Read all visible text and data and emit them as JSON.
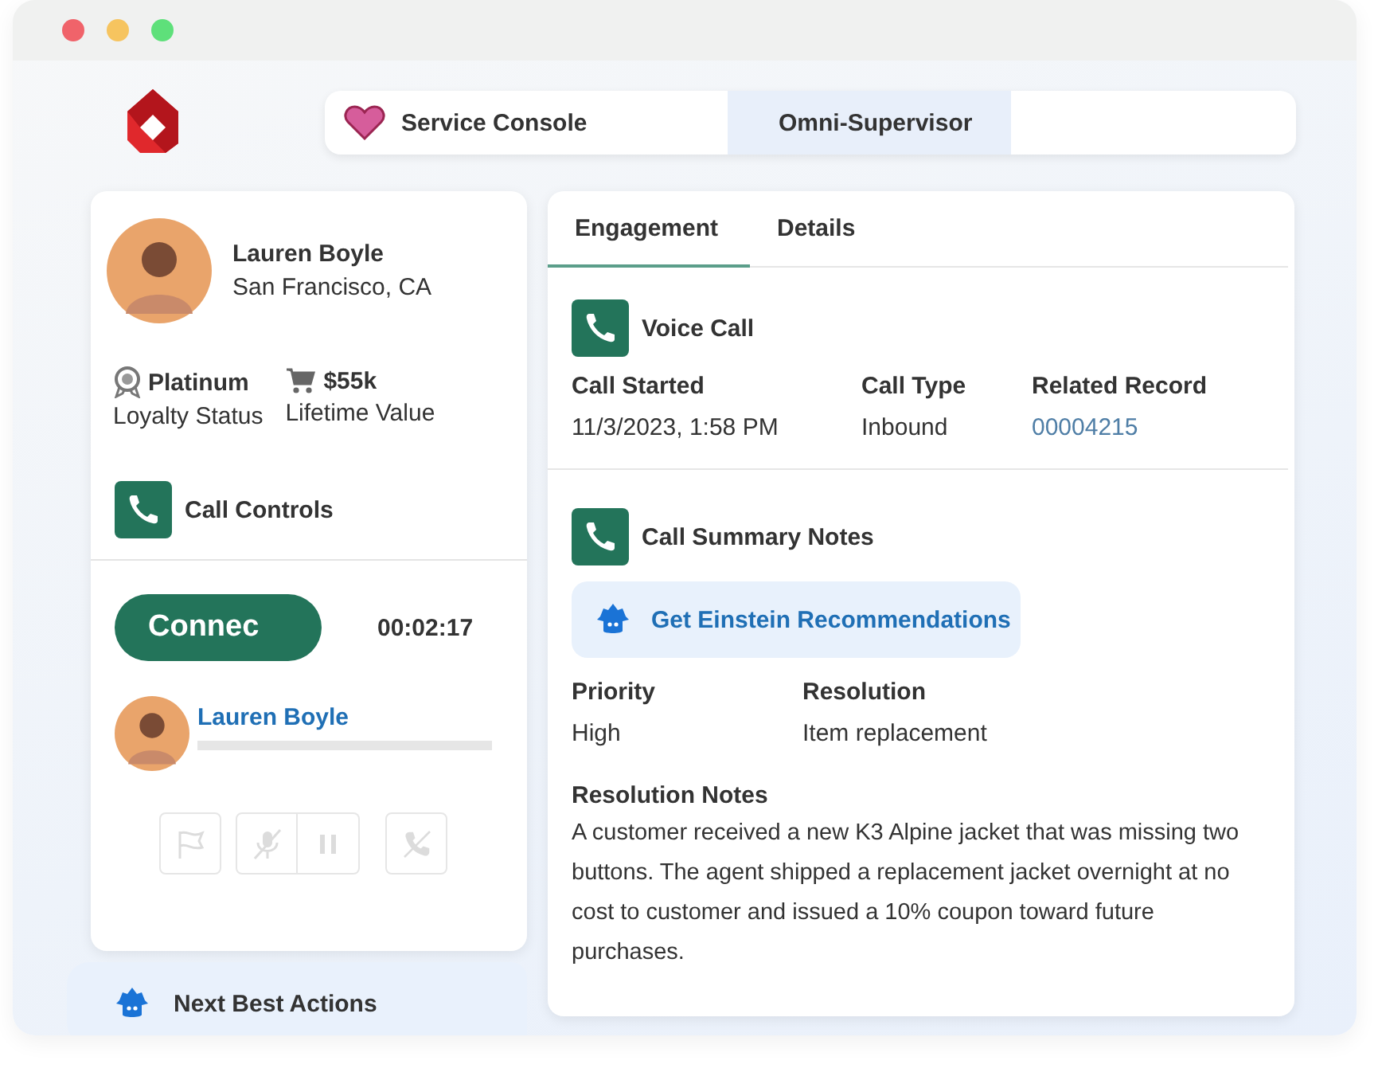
{
  "header_tabs": [
    {
      "label": "Service Console",
      "selected": false,
      "kind": "app"
    },
    {
      "label": "Omni-Supervisor",
      "selected": true,
      "kind": "plain"
    }
  ],
  "customer": {
    "name": "Lauren Boyle",
    "location": "San Francisco, CA",
    "stats": [
      {
        "kind": "award",
        "value": "Platinum",
        "label": "Loyalty Status"
      },
      {
        "kind": "cart",
        "value": "$55k",
        "label": "Lifetime Value"
      }
    ]
  },
  "call_controls": {
    "title": "Call Controls",
    "connect_button": "Connec",
    "timer": "00:02:17",
    "participant": "Lauren Boyle",
    "buttons": [
      {
        "kind": "flag",
        "disabled": true
      },
      {
        "kind": "mute",
        "disabled": true
      },
      {
        "kind": "pause",
        "disabled": true
      },
      {
        "kind": "hangup",
        "disabled": true
      }
    ]
  },
  "next_best_actions": "Next Best Actions",
  "detail_tabs": [
    {
      "label": "Engagement",
      "selected": true
    },
    {
      "label": "Details",
      "selected": false
    }
  ],
  "voice_call": {
    "title": "Voice Call",
    "fields": [
      {
        "label": "Call Started",
        "value": "11/3/2023, 1:58 PM",
        "kind": "text"
      },
      {
        "label": "Call Type",
        "value": "Inbound",
        "kind": "text"
      },
      {
        "label": "Related Record",
        "value": "00004215",
        "kind": "link"
      }
    ]
  },
  "summary": {
    "title": "Call Summary Notes",
    "einstein_button": "Get Einstein Recommendations",
    "fields": [
      {
        "label": "Priority",
        "value": "High"
      },
      {
        "label": "Resolution",
        "value": "Item replacement"
      }
    ],
    "notes_label": "Resolution Notes",
    "notes": "A customer received a new K3 Alpine jacket that was missing two buttons. The agent shipped a replacement jacket overnight at no cost to customer and issued a 10% coupon toward future purchases."
  }
}
